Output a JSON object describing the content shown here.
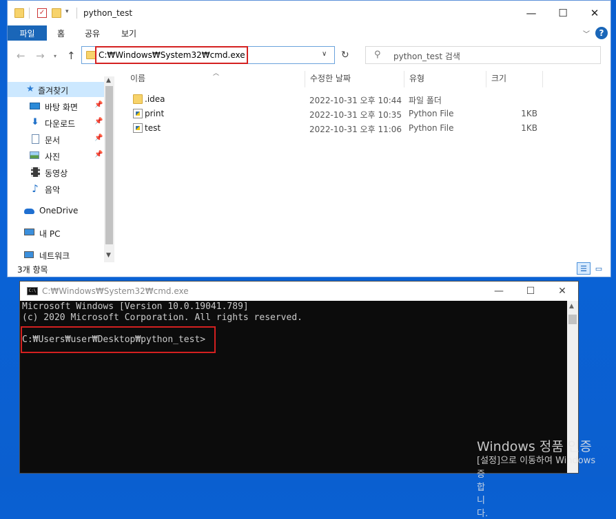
{
  "explorer": {
    "title": "python_test",
    "window_controls": {
      "minimize": "—",
      "maximize": "☐",
      "close": "✕"
    },
    "ribbon_tabs": [
      "파일",
      "홈",
      "공유",
      "보기"
    ],
    "help_label": "?",
    "address": "C:₩Windows₩System32₩cmd.exe",
    "search_placeholder": "python_test 검색",
    "nav_items": [
      {
        "label": "즐겨찾기",
        "icon": "star-icon",
        "pinned": false
      },
      {
        "label": "바탕 화면",
        "icon": "desktop-icon",
        "pinned": true
      },
      {
        "label": "다운로드",
        "icon": "download-arrow-icon",
        "pinned": true
      },
      {
        "label": "문서",
        "icon": "document-icon",
        "pinned": true
      },
      {
        "label": "사진",
        "icon": "picture-icon",
        "pinned": true
      },
      {
        "label": "동영상",
        "icon": "video-icon",
        "pinned": false
      },
      {
        "label": "음악",
        "icon": "music-note-icon",
        "pinned": false
      },
      {
        "label": "OneDrive",
        "icon": "cloud-icon",
        "pinned": false
      },
      {
        "label": "내 PC",
        "icon": "computer-icon",
        "pinned": false
      },
      {
        "label": "네트워크",
        "icon": "network-icon",
        "pinned": false
      }
    ],
    "columns": {
      "name": "이름",
      "date": "수정한 날짜",
      "type": "유형",
      "size": "크기"
    },
    "files": [
      {
        "name": ".idea",
        "date": "2022-10-31 오후 10:44",
        "type": "파일 폴더",
        "size": "",
        "icon": "folder-icon"
      },
      {
        "name": "print",
        "date": "2022-10-31 오후 10:35",
        "type": "Python File",
        "size": "1KB",
        "icon": "python-file-icon"
      },
      {
        "name": "test",
        "date": "2022-10-31 오후 11:06",
        "type": "Python File",
        "size": "1KB",
        "icon": "python-file-icon"
      }
    ],
    "status": "3개 항목"
  },
  "cmd": {
    "title": "C:₩Windows₩System32₩cmd.exe",
    "icon_label": "C:\\",
    "window_controls": {
      "minimize": "—",
      "maximize": "☐",
      "close": "✕"
    },
    "lines": [
      "Microsoft Windows [Version 10.0.19041.789]",
      "(c) 2020 Microsoft Corporation. All rights reserved.",
      "",
      "C:₩Users₩user₩Desktop₩python_test>"
    ]
  },
  "watermark": {
    "line1": "Windows 정품 인증",
    "line2": "[설정]으로 이동하여 Windows",
    "line3": "증합니다."
  }
}
